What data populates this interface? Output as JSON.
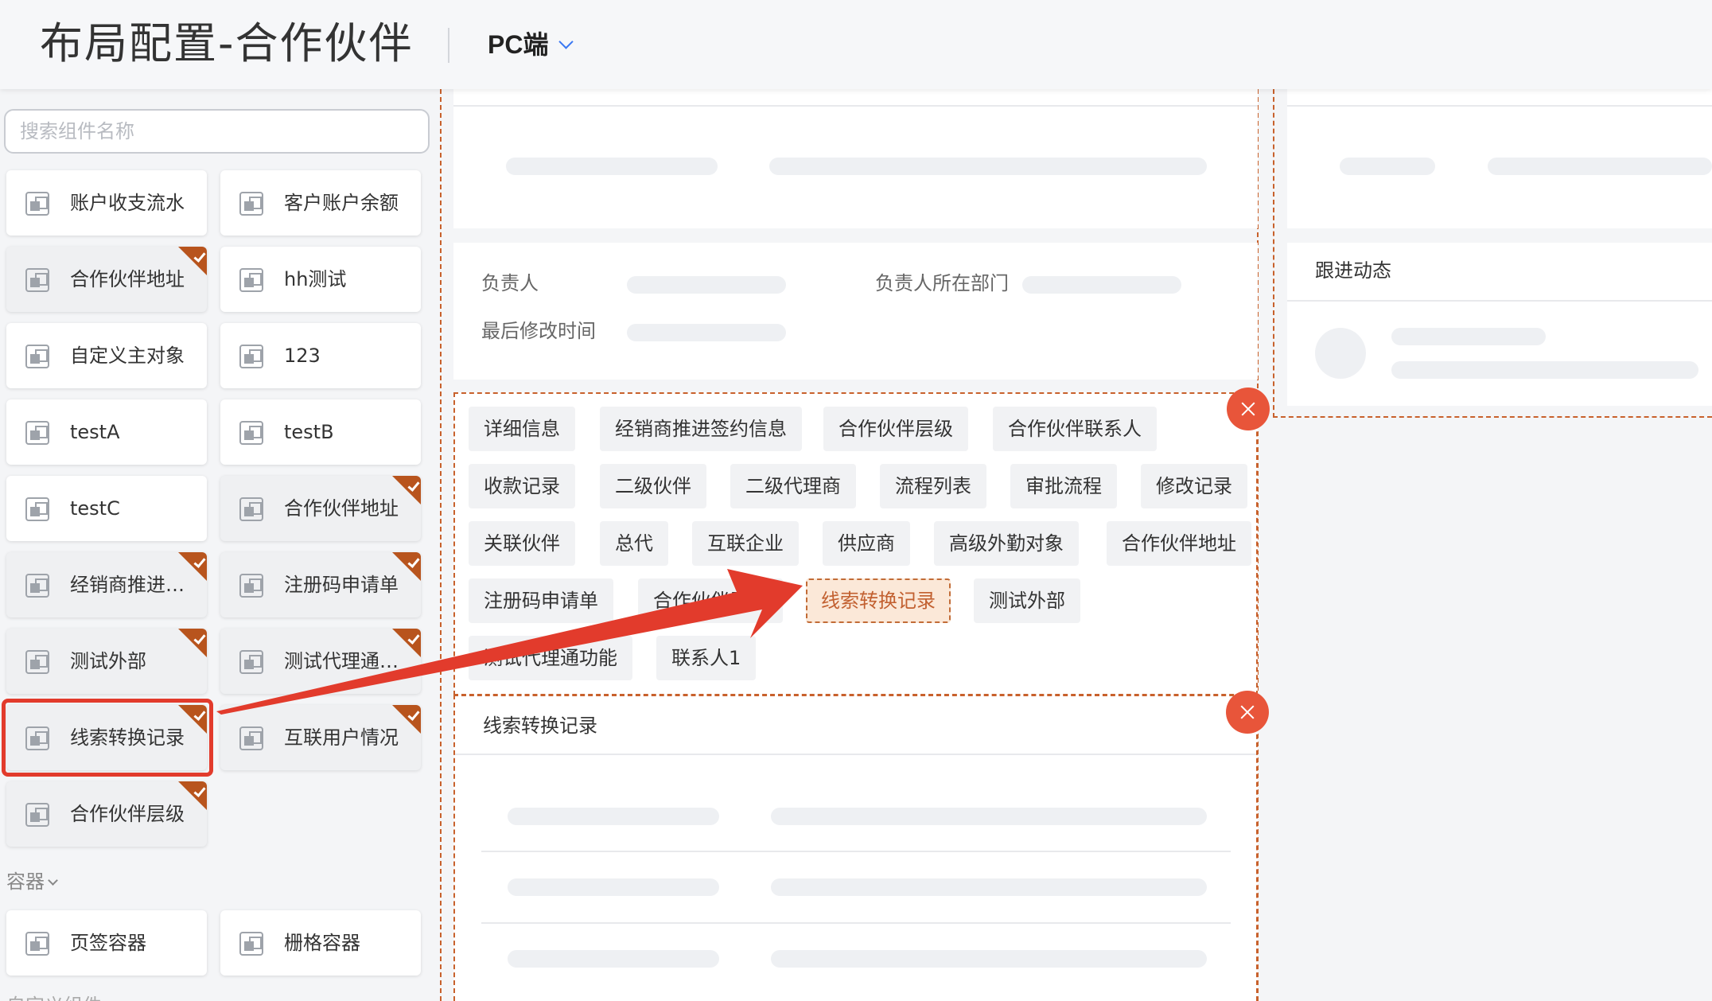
{
  "header": {
    "title": "布局配置-合作伙伴",
    "platform": "PC端"
  },
  "sidebar": {
    "search_placeholder": "搜索组件名称",
    "components": [
      {
        "label": "账户收支流水",
        "used": false
      },
      {
        "label": "客户账户余额",
        "used": false
      },
      {
        "label": "合作伙伴地址",
        "used": true
      },
      {
        "label": "hh测试",
        "used": false
      },
      {
        "label": "自定义主对象",
        "used": false
      },
      {
        "label": "123",
        "used": false
      },
      {
        "label": "testA",
        "used": false
      },
      {
        "label": "testB",
        "used": false
      },
      {
        "label": "testC",
        "used": false
      },
      {
        "label": "合作伙伴地址",
        "used": true
      },
      {
        "label": "经销商推进…",
        "used": true
      },
      {
        "label": "注册码申请单",
        "used": true
      },
      {
        "label": "测试外部",
        "used": true
      },
      {
        "label": "测试代理通…",
        "used": true
      },
      {
        "label": "线索转换记录",
        "used": true
      },
      {
        "label": "互联用户情况",
        "used": true
      },
      {
        "label": "合作伙伴层级",
        "used": true
      }
    ],
    "container_section": "容器",
    "containers": [
      {
        "label": "页签容器"
      },
      {
        "label": "栅格容器"
      }
    ],
    "custom_section": "自定义组件"
  },
  "canvas": {
    "info_fields": {
      "owner": "负责人",
      "owner_dept": "负责人所在部门",
      "last_modified": "最后修改时间"
    },
    "tabs": [
      "详细信息",
      "经销商推进签约信息",
      "合作伙伴层级",
      "合作伙伴联系人",
      "收款记录",
      "二级伙伴",
      "二级代理商",
      "流程列表",
      "审批流程",
      "修改记录",
      "关联伙伴",
      "总代",
      "互联企业",
      "供应商",
      "高级外勤对象",
      "合作伙伴地址",
      "注册码申请单",
      "合作伙伴层级",
      "线索转换记录",
      "测试外部",
      "测试代理通功能",
      "联系人1"
    ],
    "active_tab": "线索转换记录",
    "dropped_card_title": "线索转换记录"
  },
  "right_column": {
    "follow_up_title": "跟进动态"
  },
  "colors": {
    "accent_orange": "#c8612c",
    "used_corner": "#b8541d",
    "close_red": "#e8553a",
    "annotation_red": "#e23b2c",
    "link_blue": "#3a78f2"
  }
}
